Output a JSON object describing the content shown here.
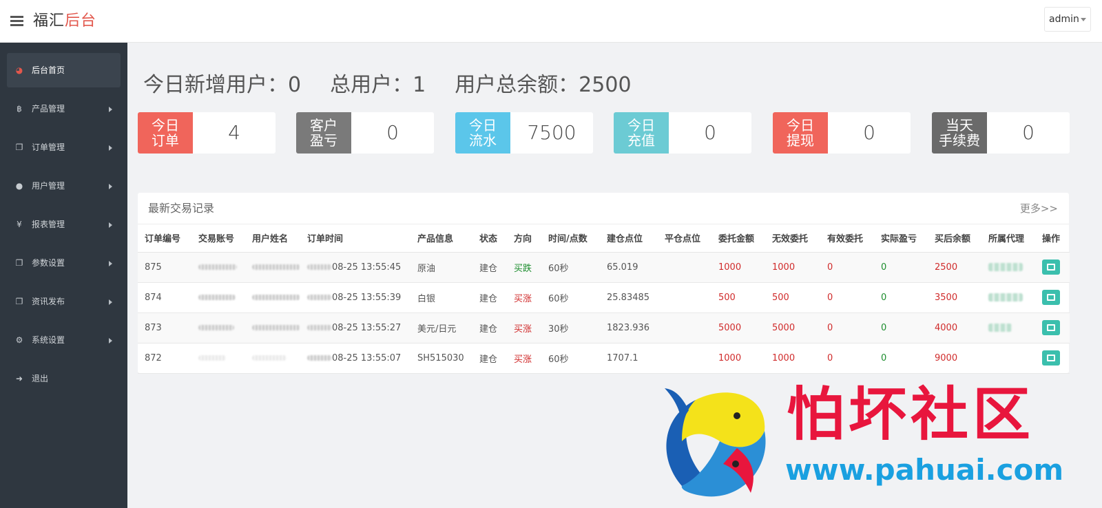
{
  "header": {
    "brand_black": "福汇",
    "brand_red": "后台",
    "user": "admin"
  },
  "sidebar": {
    "items": [
      {
        "label": "后台首页",
        "icon": "dashboard-icon",
        "active": true
      },
      {
        "label": "产品管理",
        "icon": "bitcoin-icon"
      },
      {
        "label": "订单管理",
        "icon": "copy-icon"
      },
      {
        "label": "用户管理",
        "icon": "user-icon"
      },
      {
        "label": "报表管理",
        "icon": "yen-icon"
      },
      {
        "label": "参数设置",
        "icon": "copy-icon"
      },
      {
        "label": "资讯发布",
        "icon": "copy-icon"
      },
      {
        "label": "系统设置",
        "icon": "gears-icon"
      },
      {
        "label": "退出",
        "icon": "sign-out-icon"
      }
    ]
  },
  "summary": {
    "new_users": "今日新增用户：0",
    "total_users": "总用户：1",
    "total_balance": "用户总余额：2500"
  },
  "stats": [
    {
      "l1": "今日",
      "l2": "订单",
      "value": "4",
      "color": "#f0655b"
    },
    {
      "l1": "客户",
      "l2": "盈亏",
      "value": "0",
      "color": "#7a7a7a"
    },
    {
      "l1": "今日",
      "l2": "流水",
      "value": "7500",
      "color": "#5bc6ea"
    },
    {
      "l1": "今日",
      "l2": "充值",
      "value": "0",
      "color": "#6ccbd4"
    },
    {
      "l1": "今日",
      "l2": "提现",
      "value": "0",
      "color": "#f0655b"
    },
    {
      "l1": "当天",
      "l2": "手续费",
      "value": "0",
      "color": "#6a6a6a"
    }
  ],
  "panel": {
    "title": "最新交易记录",
    "more": "更多>>"
  },
  "table": {
    "headers": [
      "订单编号",
      "交易账号",
      "用户姓名",
      "订单时间",
      "产品信息",
      "状态",
      "方向",
      "时间/点数",
      "建仓点位",
      "平仓点位",
      "委托金额",
      "无效委托",
      "有效委托",
      "实际盈亏",
      "买后余额",
      "所属代理",
      "操作"
    ],
    "rows": [
      {
        "id": "875",
        "time": "08-25 13:55:45",
        "product": "原油",
        "status": "建仓",
        "direction": "买跌",
        "dir_color": "green",
        "duration": "60秒",
        "open": "65.019",
        "close": "",
        "amount": "1000",
        "invalid": "1000",
        "valid": "0",
        "pnl": "0",
        "balance": "2500"
      },
      {
        "id": "874",
        "time": "08-25 13:55:39",
        "product": "白银",
        "status": "建仓",
        "direction": "买涨",
        "dir_color": "red",
        "duration": "60秒",
        "open": "25.83485",
        "close": "",
        "amount": "500",
        "invalid": "500",
        "valid": "0",
        "pnl": "0",
        "balance": "3500"
      },
      {
        "id": "873",
        "time": "08-25 13:55:27",
        "product": "美元/日元",
        "status": "建仓",
        "direction": "买涨",
        "dir_color": "red",
        "duration": "30秒",
        "open": "1823.936",
        "close": "",
        "amount": "5000",
        "invalid": "5000",
        "valid": "0",
        "pnl": "0",
        "balance": "4000"
      },
      {
        "id": "872",
        "time": "08-25 13:55:07",
        "product": "SH515030",
        "status": "建仓",
        "direction": "买涨",
        "dir_color": "red",
        "duration": "60秒",
        "open": "1707.1",
        "close": "",
        "amount": "1000",
        "invalid": "1000",
        "valid": "0",
        "pnl": "0",
        "balance": "9000"
      }
    ]
  },
  "watermark": {
    "text": "怕坏社区",
    "url": "www.pahuai.com"
  }
}
